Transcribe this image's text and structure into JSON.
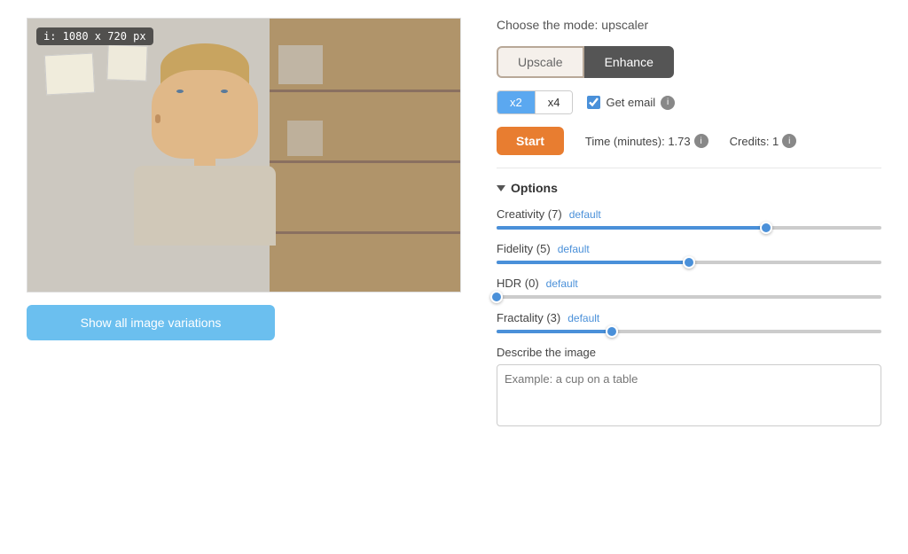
{
  "image": {
    "badge": "i: 1080 x 720 px"
  },
  "header": {
    "mode_label": "Choose the mode: upscaler"
  },
  "mode_buttons": {
    "upscale": "Upscale",
    "enhance": "Enhance"
  },
  "scale": {
    "x2_label": "x2",
    "x4_label": "x4"
  },
  "email": {
    "label": "Get email"
  },
  "start": {
    "label": "Start"
  },
  "time": {
    "label": "Time (minutes): 1.73"
  },
  "credits": {
    "label": "Credits: 1"
  },
  "options": {
    "label": "Options"
  },
  "sliders": {
    "creativity": {
      "label": "Creativity (7)",
      "default_link": "default",
      "value": 7,
      "max": 10,
      "percent": 70
    },
    "fidelity": {
      "label": "Fidelity (5)",
      "default_link": "default",
      "value": 5,
      "max": 10,
      "percent": 50
    },
    "hdr": {
      "label": "HDR (0)",
      "default_link": "default",
      "value": 0,
      "max": 10,
      "percent": 0
    },
    "fractality": {
      "label": "Fractality (3)",
      "default_link": "default",
      "value": 3,
      "max": 10,
      "percent": 30
    }
  },
  "describe": {
    "label": "Describe the image",
    "placeholder": "Example: a cup on a table"
  },
  "show_variations": {
    "label": "Show all image variations"
  }
}
